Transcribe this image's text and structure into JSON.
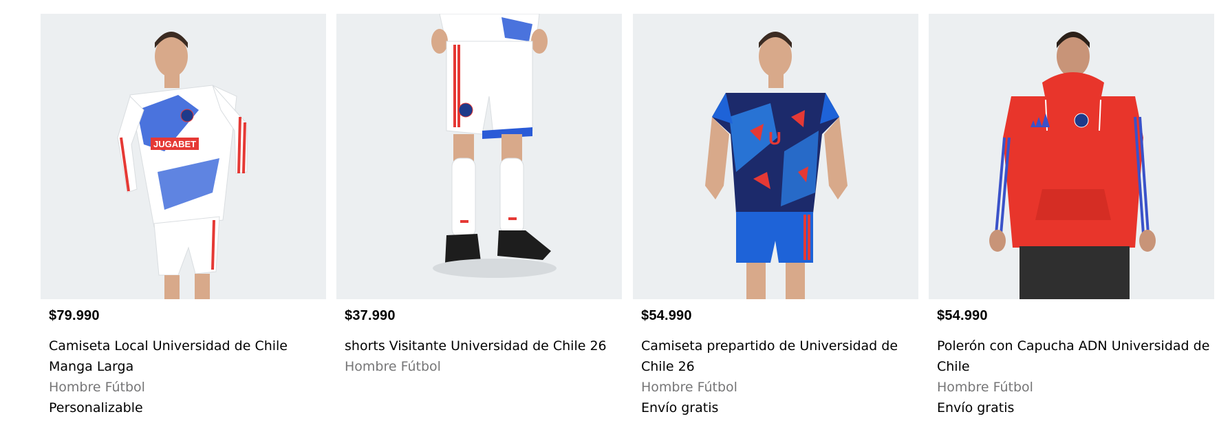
{
  "products": [
    {
      "price": "$79.990",
      "title": "Camiseta Local Universidad de Chile Manga Larga",
      "category": "Hombre Fútbol",
      "badge": "Personalizable",
      "image_alt": "Camiseta Local Universidad de Chile Manga Larga",
      "colors": {
        "main": "#ffffff",
        "accent": "#2a5bd7",
        "stripe": "#e53935"
      }
    },
    {
      "price": "$37.990",
      "title": "shorts Visitante Universidad de Chile 26",
      "category": "Hombre Fútbol",
      "badge": "",
      "image_alt": "shorts Visitante Universidad de Chile 26",
      "colors": {
        "main": "#ffffff",
        "accent": "#2a5bd7",
        "stripe": "#e53935"
      }
    },
    {
      "price": "$54.990",
      "title": "Camiseta prepartido de Universidad de Chile 26",
      "category": "Hombre Fútbol",
      "badge": "Envío gratis",
      "image_alt": "Camiseta prepartido de Universidad de Chile 26",
      "colors": {
        "main": "#1c2a6b",
        "accent": "#1e63d8",
        "stripe": "#e53935"
      }
    },
    {
      "price": "$54.990",
      "title": "Polerón con Capucha ADN Universidad de Chile",
      "category": "Hombre Fútbol",
      "badge": "Envío gratis",
      "image_alt": "Polerón con Capucha ADN Universidad de Chile",
      "colors": {
        "main": "#e8352b",
        "accent": "#3a52c9",
        "stripe": "#3a52c9"
      }
    }
  ]
}
